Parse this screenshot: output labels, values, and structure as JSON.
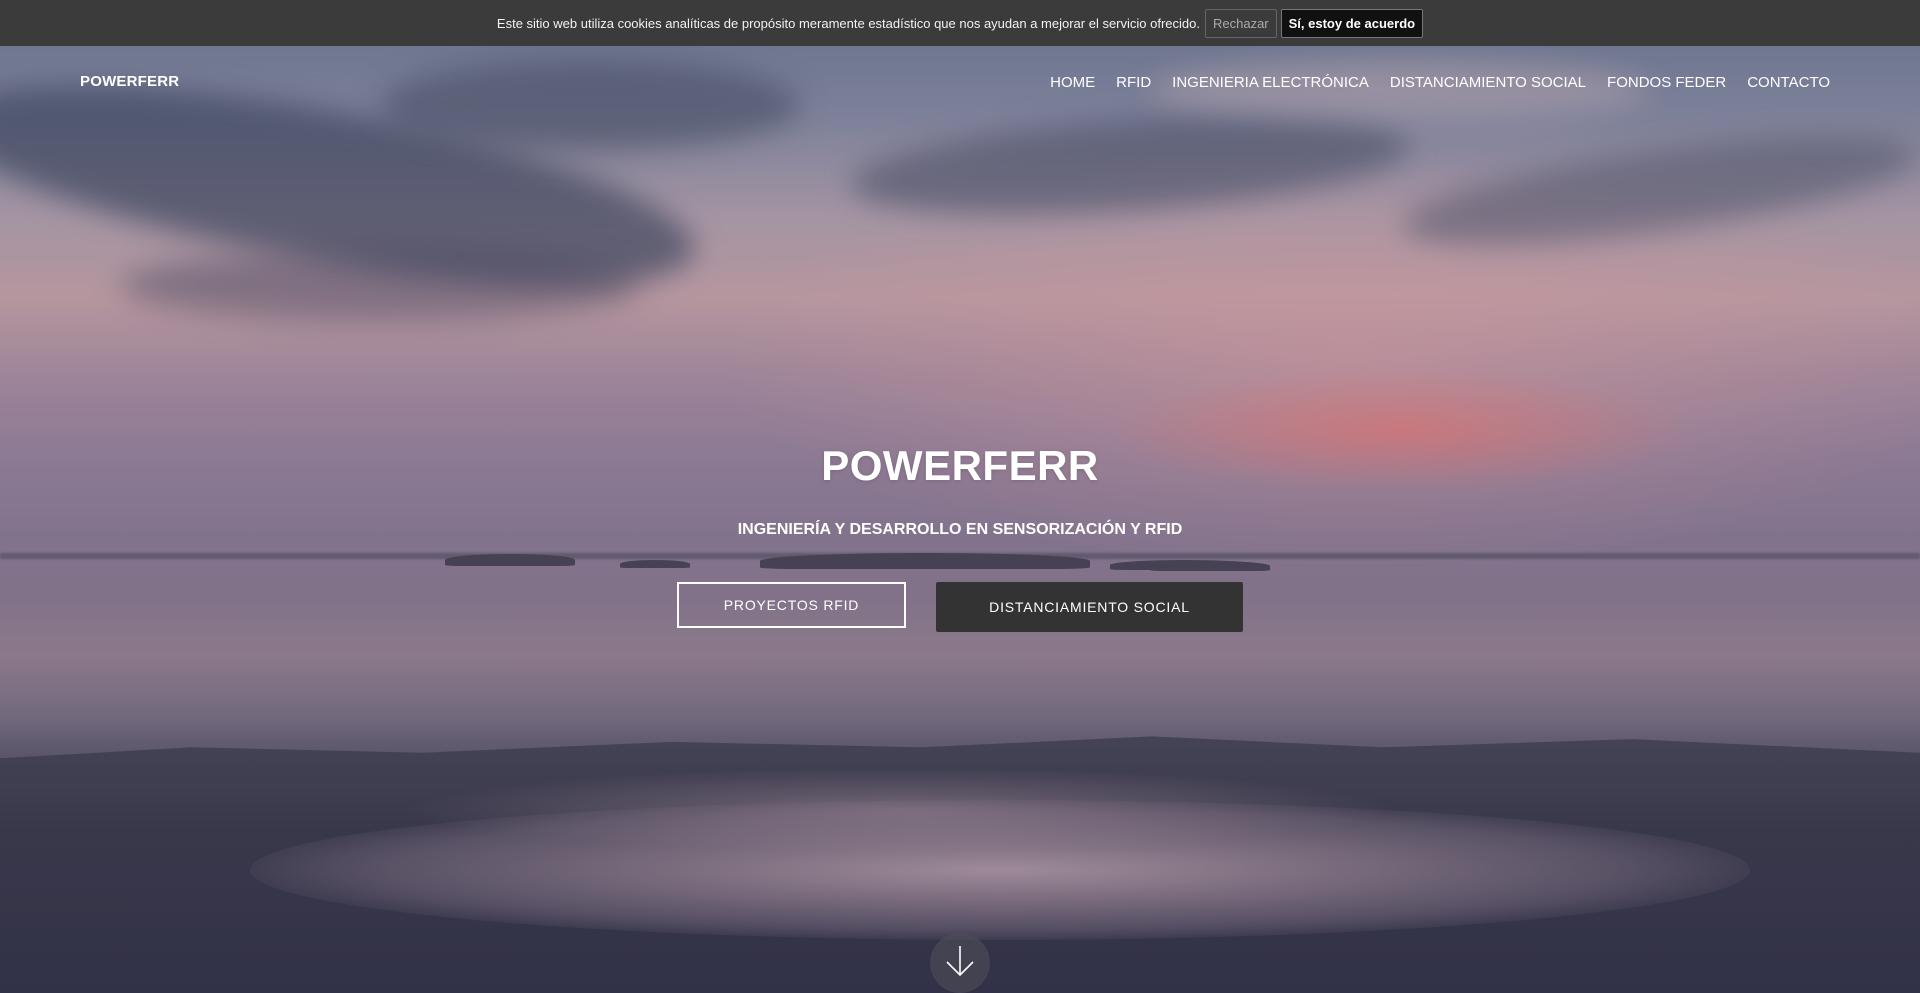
{
  "cookie_bar": {
    "message": "Este sitio web utiliza cookies analíticas de propósito meramente estadístico que nos ayudan a mejorar el servicio ofrecido.",
    "reject_label": "Rechazar",
    "accept_label": "Sí, estoy de acuerdo"
  },
  "header": {
    "brand": "POWERFERR",
    "nav": [
      "HOME",
      "RFID",
      "INGENIERIA ELECTRÓNICA",
      "DISTANCIAMIENTO SOCIAL",
      "FONDOS FEDER",
      "CONTACTO"
    ]
  },
  "hero": {
    "title": "POWERFERR",
    "subtitle": "INGENIERÍA Y DESARROLLO EN SENSORIZACIÓN Y RFID",
    "primary_button": "PROYECTOS RFID",
    "secondary_button": "DISTANCIAMIENTO SOCIAL",
    "scroll_icon": "arrow-down-icon"
  },
  "colors": {
    "cookie_bar_bg": "#3b3b3b",
    "accept_bg": "#111111",
    "dark_button_bg": "#333333"
  }
}
